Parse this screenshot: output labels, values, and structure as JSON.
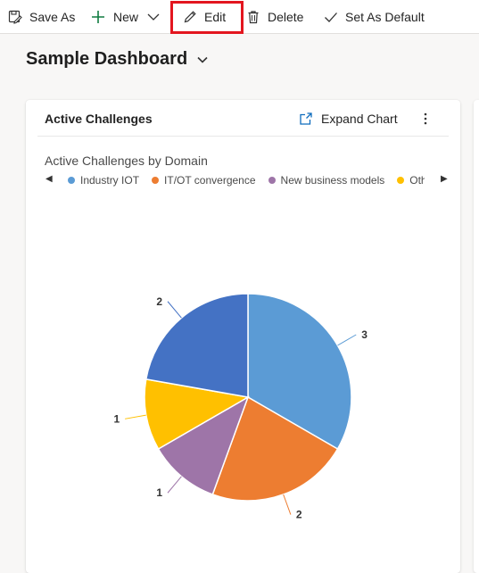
{
  "toolbar": {
    "save_as": "Save As",
    "new": "New",
    "edit": "Edit",
    "delete": "Delete",
    "set_default": "Set As Default"
  },
  "dashboard": {
    "title": "Sample Dashboard"
  },
  "card": {
    "title": "Active Challenges",
    "expand_label": "Expand Chart"
  },
  "colors": {
    "highlight": "#e3161f",
    "accent": "#0f6cbd"
  },
  "chart_data": {
    "type": "pie",
    "title": "Active Challenges by Domain",
    "legend_position": "top",
    "slices": [
      {
        "name": "Industry IOT",
        "value": 3,
        "color": "#5b9bd5"
      },
      {
        "name": "IT/OT convergence",
        "value": 2,
        "color": "#ed7d31"
      },
      {
        "name": "New business models",
        "value": 1,
        "color": "#9e75a8"
      },
      {
        "name": "Oth",
        "value": 1,
        "color": "#ffc000"
      },
      {
        "name": "",
        "value": 2,
        "color": "#4472c4"
      }
    ]
  }
}
